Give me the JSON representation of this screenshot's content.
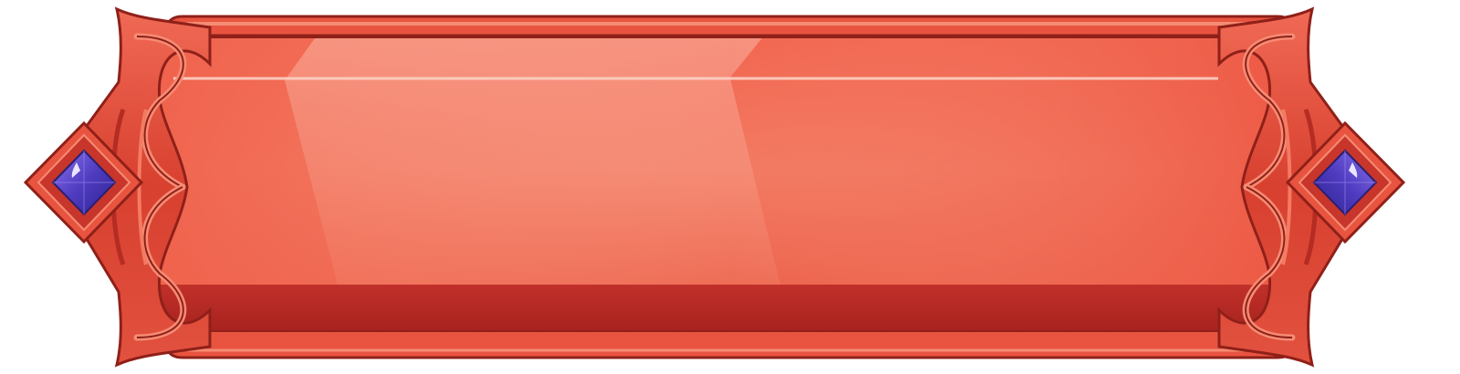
{
  "banner": {
    "label": ""
  },
  "colors": {
    "frame_outer": "#e8543f",
    "frame_dark": "#8f2019",
    "frame_mid": "#c8352a",
    "frame_light": "#f58c74",
    "panel_top": "#f26a52",
    "panel_mid": "#f37b63",
    "panel_bottom": "#e45440",
    "panel_band": "#b82a24",
    "shine": "#f9b7a5",
    "corner_shadow": "#3a2e2e",
    "gem_dark": "#3a2ba0",
    "gem_light": "#7a61e0",
    "gem_highlight": "#e9e6ff"
  },
  "icons": {
    "left_ornament": "pointed-diamond-gem-ornament",
    "right_ornament": "pointed-diamond-gem-ornament"
  }
}
